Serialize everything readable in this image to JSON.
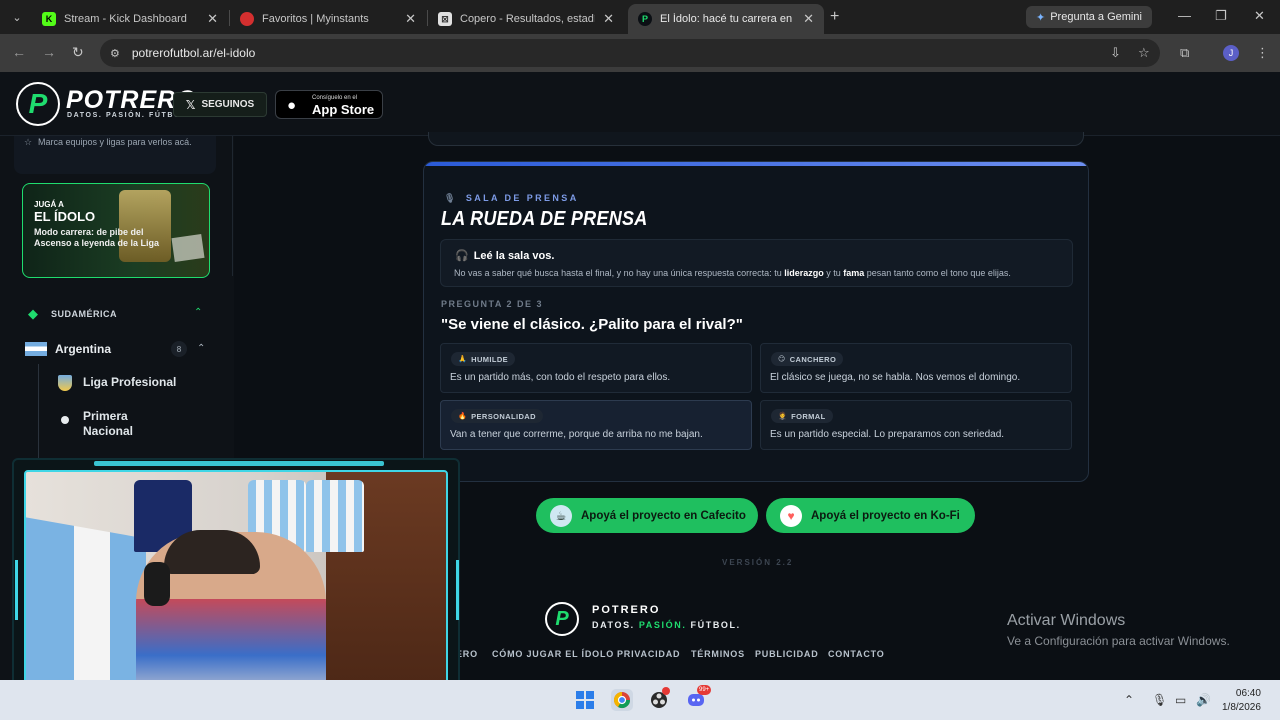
{
  "browser": {
    "tabs": [
      {
        "title": "Stream - Kick Dashboard",
        "icon": "kick-icon",
        "color": "#53fc18"
      },
      {
        "title": "Favoritos | Myinstants",
        "icon": "myinstants-icon",
        "color": "#d32f2f"
      },
      {
        "title": "Copero - Resultados, estadístic",
        "icon": "copero-icon",
        "color": "#e0e0e0"
      },
      {
        "title": "El Ídolo: hacé tu carrera en la Li",
        "icon": "potrero-icon",
        "color": "#1fdc6e"
      }
    ],
    "gemini_label": "Pregunta a Gemini",
    "url": "potrerofutbol.ar/el-idolo",
    "profile_initial": "J"
  },
  "header": {
    "brand": "POTRERO",
    "tagline": "DATOS. PASIÓN. FÚTBOL.",
    "follow_label": "SEGUINOS",
    "appstore_small": "Consíguelo en el",
    "appstore_big": "App Store"
  },
  "sidebar": {
    "hint": "Marca equipos y ligas para verlos acá.",
    "promo": {
      "kicker": "JUGÁ A",
      "title": "EL ÍDOLO",
      "text": "Modo carrera: de pibe del Ascenso a leyenda de la Liga"
    },
    "region": "SUDAMÉRICA",
    "country": {
      "name": "Argentina",
      "count": "8"
    },
    "leagues": [
      "Liga Profesional",
      "Primera Nacional"
    ]
  },
  "panel": {
    "kicker": "SALA DE PRENSA",
    "title": "LA RUEDA DE PRENSA",
    "info_title": "Leé la sala vos.",
    "info_text_1": "No vas a saber qué busca hasta el final, y no hay una única respuesta correcta: tu ",
    "info_bold_1": "liderazgo",
    "info_text_2": " y tu ",
    "info_bold_2": "fama",
    "info_text_3": " pesan tanto como el tono que elijas.",
    "question_count": "PREGUNTA 2 DE 3",
    "question": "\"Se viene el clásico. ¿Palito para el rival?\"",
    "options": [
      {
        "tag": "HUMILDE",
        "emoji": "🙏",
        "text": "Es un partido más, con todo el respeto para ellos."
      },
      {
        "tag": "CANCHERO",
        "emoji": "😏",
        "text": "El clásico se juega, no se habla. Nos vemos el domingo."
      },
      {
        "tag": "PERSONALIDAD",
        "emoji": "🔥",
        "text": "Van a tener que correrme, porque de arriba no me bajan."
      },
      {
        "tag": "FORMAL",
        "emoji": "🤵",
        "text": "Es un partido especial. Lo preparamos con seriedad."
      }
    ],
    "progress": {
      "answered": 1,
      "total": 3
    }
  },
  "support": {
    "cafecito": "Apoyá el proyecto en Cafecito",
    "kofi": "Apoyá el proyecto en Ko-Fi"
  },
  "version": "VERSIÓN 2.2",
  "footer": {
    "brand": "POTRERO",
    "tag_a": "DATOS. ",
    "tag_b": "PASIÓN.",
    "tag_c": " FÚTBOL.",
    "links": [
      "ERO",
      "CÓMO JUGAR EL ÍDOLO",
      "PRIVACIDAD",
      "TÉRMINOS",
      "PUBLICIDAD",
      "CONTACTO"
    ]
  },
  "windows_watermark": {
    "line1": "Activar Windows",
    "line2": "Ve a Configuración para activar Windows."
  },
  "taskbar": {
    "time": "06:40",
    "date": "1/8/2026",
    "discord_badge": "99+"
  },
  "colors": {
    "accent": "#1fdc6e",
    "panel_blue": "#2f67d8"
  }
}
